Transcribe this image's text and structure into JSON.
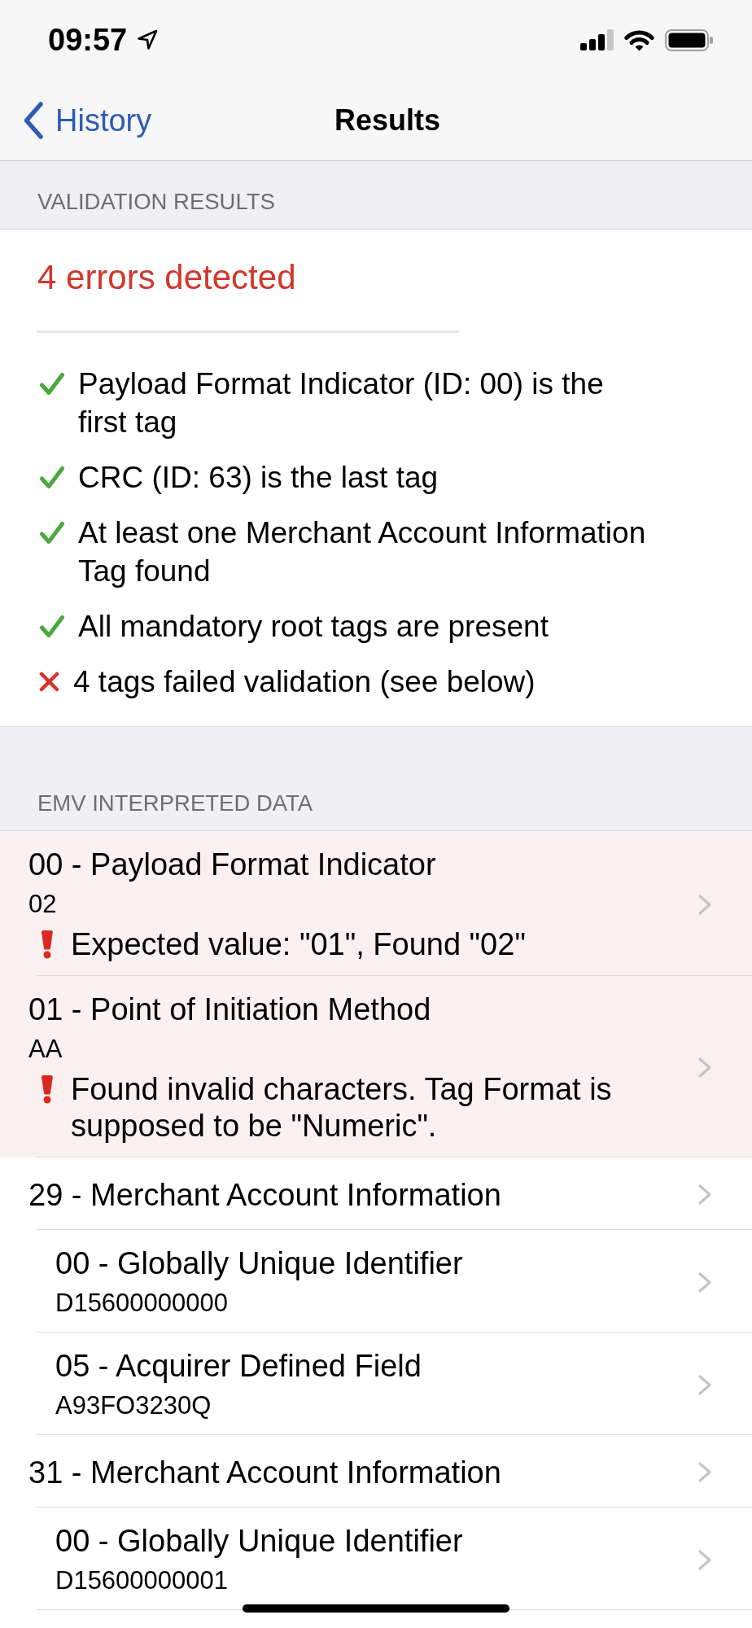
{
  "status_bar": {
    "time": "09:57"
  },
  "nav": {
    "back": "History",
    "title": "Results"
  },
  "validation": {
    "header": "VALIDATION RESULTS",
    "summary": "4 errors detected",
    "checks": [
      {
        "text": "Payload Format Indicator (ID: 00) is the first tag",
        "passed": true
      },
      {
        "text": "CRC (ID: 63) is the last tag",
        "passed": true
      },
      {
        "text": "At least one Merchant Account Information Tag found",
        "passed": true
      },
      {
        "text": "All mandatory root tags are present",
        "passed": true
      },
      {
        "text": "4 tags failed validation (see below)",
        "passed": false
      }
    ]
  },
  "emv": {
    "header": "EMV INTERPRETED DATA",
    "rows": [
      {
        "title": "00 - Payload Format Indicator",
        "value": "02",
        "error": "Expected value: \"01\", Found \"02\"",
        "invalid": true
      },
      {
        "title": "01 - Point of Initiation Method",
        "value": "AA",
        "error": "Found invalid characters. Tag Format is supposed to be \"Numeric\".",
        "invalid": true
      },
      {
        "title": "29 - Merchant Account Information",
        "invalid": false,
        "children": [
          {
            "title": "00 - Globally Unique Identifier",
            "value": "D15600000000",
            "invalid": false
          },
          {
            "title": "05 - Acquirer Defined Field",
            "value": "A93FO3230Q",
            "invalid": false
          }
        ]
      },
      {
        "title": "31 - Merchant Account Information",
        "invalid": false,
        "children": [
          {
            "title": "00 - Globally Unique Identifier",
            "value": "D15600000001",
            "invalid": false
          }
        ]
      }
    ]
  }
}
